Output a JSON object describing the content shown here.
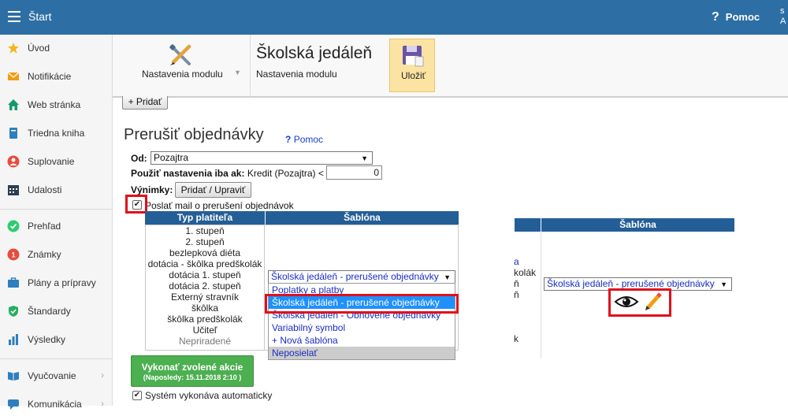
{
  "topbar": {
    "title": "Štart",
    "help": "Pomoc",
    "user_initials": "S\nA"
  },
  "sidebar": {
    "items": [
      {
        "label": "Úvod",
        "icon": "star-icon",
        "color": "#f2b51d"
      },
      {
        "label": "Notifikácie",
        "icon": "envelope-icon",
        "color": "#f39c12"
      },
      {
        "label": "Web stránka",
        "icon": "house-icon",
        "color": "#159a6b"
      },
      {
        "label": "Triedna kniha",
        "icon": "book-icon",
        "color": "#2e7fbf"
      },
      {
        "label": "Suplovanie",
        "icon": "person-icon",
        "color": "#e74c3c"
      },
      {
        "label": "Udalosti",
        "icon": "calendar-icon",
        "color": "#2c3e50"
      },
      {
        "label": "Prehľad",
        "icon": "check-circle-icon",
        "color": "#2ecc71"
      },
      {
        "label": "Známky",
        "icon": "grade-icon",
        "color": "#e74c3c"
      },
      {
        "label": "Plány a prípravy",
        "icon": "briefcase-icon",
        "color": "#2e7fbf"
      },
      {
        "label": "Štandardy",
        "icon": "shield-icon",
        "color": "#27ae60"
      },
      {
        "label": "Výsledky",
        "icon": "bar-chart-icon",
        "color": "#2e7fbf"
      },
      {
        "label": "Vyučovanie",
        "icon": "book-open-icon",
        "color": "#2e7fbf"
      },
      {
        "label": "Komunikácia",
        "icon": "chat-icon",
        "color": "#2e7fbf"
      }
    ]
  },
  "toolbar": {
    "module_label": "Nastavenia modulu",
    "title": "Školská jedáleň",
    "subtitle": "Nastavenia modulu",
    "save_label": "Uložiť"
  },
  "page": {
    "add_label": "+ Pridať",
    "heading": "Prerušiť objednávky",
    "help_q": "?",
    "help_link": "Pomoc",
    "od_label": "Od:",
    "od_value": "Pozajtra",
    "settings_label": "Použiť nastavenia iba ak:",
    "settings_condition": "Kredit (Pozajtra) <",
    "credit_value": "0",
    "exceptions_label": "Výnimky:",
    "exceptions_button": "Pridať / Upraviť",
    "send_mail_label": "Poslať mail o prerušení objednávok",
    "send_mail_checked": true,
    "table": {
      "col_type": "Typ platiteľa",
      "col_template": "Šablóna",
      "payer_types": [
        "1. stupeň",
        "2. stupeň",
        "bezlepková diéta",
        "dotácia - škôlka predškolák",
        "dotácia 1. stupeň",
        "dotácia 2. stupeň",
        "Externý stravník",
        "škôlka",
        "škôlka predškolák",
        "Učiteľ",
        "Nepriradené"
      ],
      "selected_template": "Školská jedáleň - prerušené objednávky",
      "options": [
        "Poplatky a platby",
        "Školská jedáleň - prerušené objednávky",
        "Školská jedáleň - Obnovené objednávky",
        "Variabilný symbol",
        "+ Nová šablóna",
        "Neposielať"
      ]
    },
    "execute_button": "Vykonať zvolené akcie",
    "execute_last": "(Naposledy: 15.11.2018 2:10 )",
    "auto_label": "Systém vykonáva automaticky",
    "auto_checked": true
  },
  "zoom_panel": {
    "col_template": "Šablóna",
    "selected_template": "Školská jedáleň - prerušené objednávky",
    "partial_rows": [
      "a",
      "kolák",
      "ň",
      "ň",
      "",
      "",
      "",
      "k"
    ]
  },
  "colors": {
    "header_blue": "#2d6ea5",
    "table_head": "#245e96",
    "highlight_red": "#e0101c",
    "save_bg": "#fbe4a3",
    "green_btn": "#4caf50"
  }
}
